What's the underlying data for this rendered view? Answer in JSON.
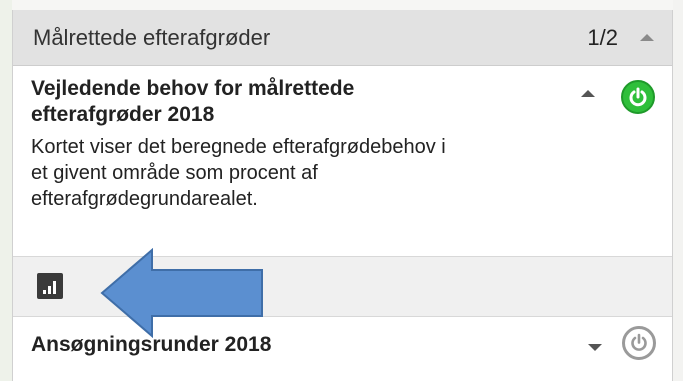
{
  "group": {
    "title": "Målrettede efterafgrøder",
    "count": "1/2"
  },
  "layers": [
    {
      "title": "Vejledende behov for målrettede efterafgrøder 2018",
      "description": "Kortet viser det beregnede efterafgrødebehov i et givent område som procent af efterafgrødegrundarealet.",
      "expanded": true,
      "visible": true,
      "toggle_color": "#2fbf3a"
    },
    {
      "title": "Ansøgningsrunder 2018",
      "expanded": false,
      "visible": false,
      "toggle_color": "#9a9a9a"
    }
  ],
  "toolbar": {
    "icon": "legend-bar-chart-icon"
  },
  "annotation": {
    "icon": "pointer-arrow-icon",
    "color": "#5b8fd0"
  }
}
